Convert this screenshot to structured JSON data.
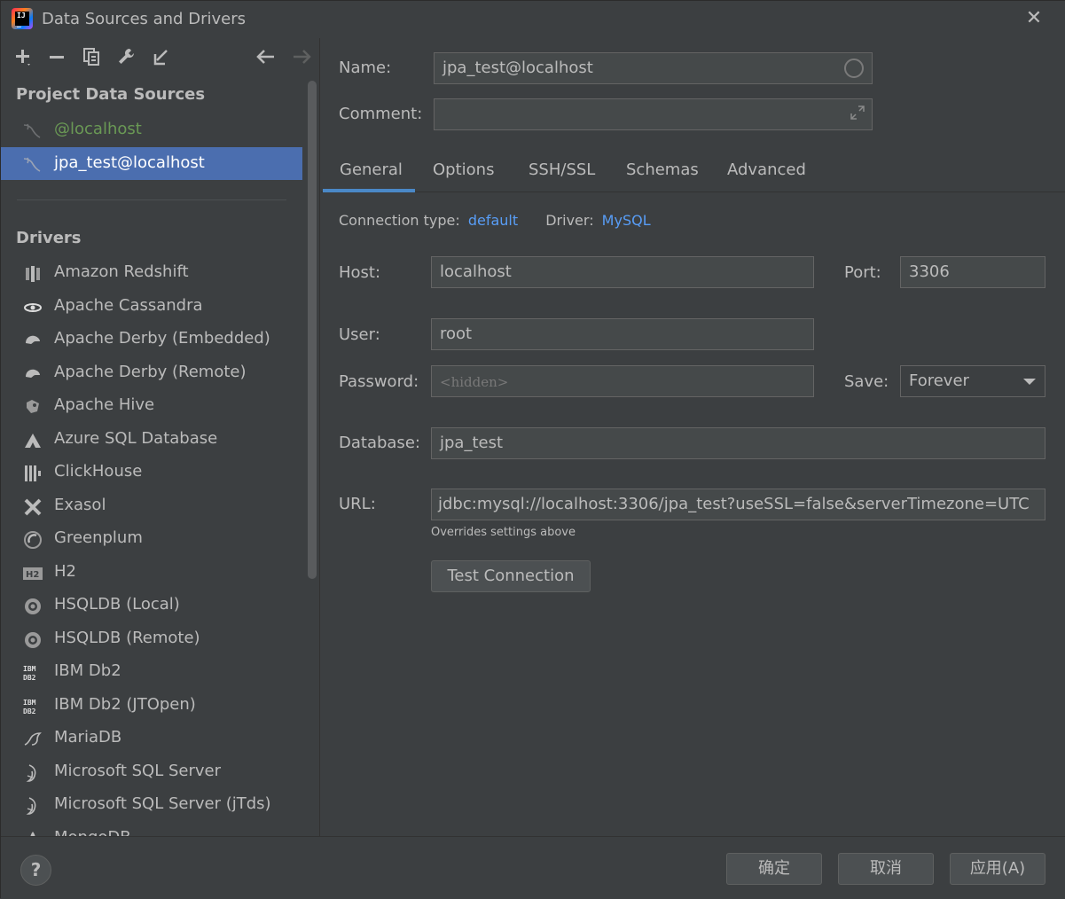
{
  "window": {
    "title": "Data Sources and Drivers"
  },
  "sidebar": {
    "project_header": "Project Data Sources",
    "data_sources": [
      {
        "label": "@localhost",
        "color": "#6a9955"
      },
      {
        "label": "jpa_test@localhost",
        "color": "#ffffff"
      }
    ],
    "drivers_header": "Drivers",
    "drivers": [
      {
        "label": "Amazon Redshift",
        "icon": "redshift-icon"
      },
      {
        "label": "Apache Cassandra",
        "icon": "cassandra-icon"
      },
      {
        "label": "Apache Derby (Embedded)",
        "icon": "derby-icon"
      },
      {
        "label": "Apache Derby (Remote)",
        "icon": "derby-icon"
      },
      {
        "label": "Apache Hive",
        "icon": "hive-icon"
      },
      {
        "label": "Azure SQL Database",
        "icon": "azure-icon"
      },
      {
        "label": "ClickHouse",
        "icon": "clickhouse-icon"
      },
      {
        "label": "Exasol",
        "icon": "exasol-icon"
      },
      {
        "label": "Greenplum",
        "icon": "greenplum-icon"
      },
      {
        "label": "H2",
        "icon": "h2-icon"
      },
      {
        "label": "HSQLDB (Local)",
        "icon": "hsqldb-icon"
      },
      {
        "label": "HSQLDB (Remote)",
        "icon": "hsqldb-icon"
      },
      {
        "label": "IBM Db2",
        "icon": "db2-icon"
      },
      {
        "label": "IBM Db2 (JTOpen)",
        "icon": "db2-icon"
      },
      {
        "label": "MariaDB",
        "icon": "mariadb-icon"
      },
      {
        "label": "Microsoft SQL Server",
        "icon": "mssql-icon"
      },
      {
        "label": "Microsoft SQL Server (jTds)",
        "icon": "mssql-icon"
      },
      {
        "label": "MongoDB",
        "icon": "mongodb-icon"
      }
    ]
  },
  "form": {
    "name_label": "Name:",
    "name_value": "jpa_test@localhost",
    "comment_label": "Comment:",
    "comment_value": "",
    "tabs": [
      "General",
      "Options",
      "SSH/SSL",
      "Schemas",
      "Advanced"
    ],
    "active_tab": "General",
    "connection_type_label": "Connection type:",
    "connection_type_value": "default",
    "driver_label": "Driver:",
    "driver_value": "MySQL",
    "host_label": "Host:",
    "host_value": "localhost",
    "port_label": "Port:",
    "port_value": "3306",
    "user_label": "User:",
    "user_value": "root",
    "password_label": "Password:",
    "password_placeholder": "<hidden>",
    "save_label": "Save:",
    "save_value": "Forever",
    "database_label": "Database:",
    "database_value": "jpa_test",
    "url_label": "URL:",
    "url_value": "jdbc:mysql://localhost:3306/jpa_test?useSSL=false&serverTimezone=UTC",
    "url_hint": "Overrides settings above",
    "test_connection_label": "Test Connection"
  },
  "footer": {
    "help_label": "?",
    "ok_label": "确定",
    "cancel_label": "取消",
    "apply_label": "应用(A)"
  },
  "colors": {
    "accent": "#4a88c7",
    "link": "#589df6",
    "selection": "#4b6eaf",
    "background": "#3c3f41"
  }
}
